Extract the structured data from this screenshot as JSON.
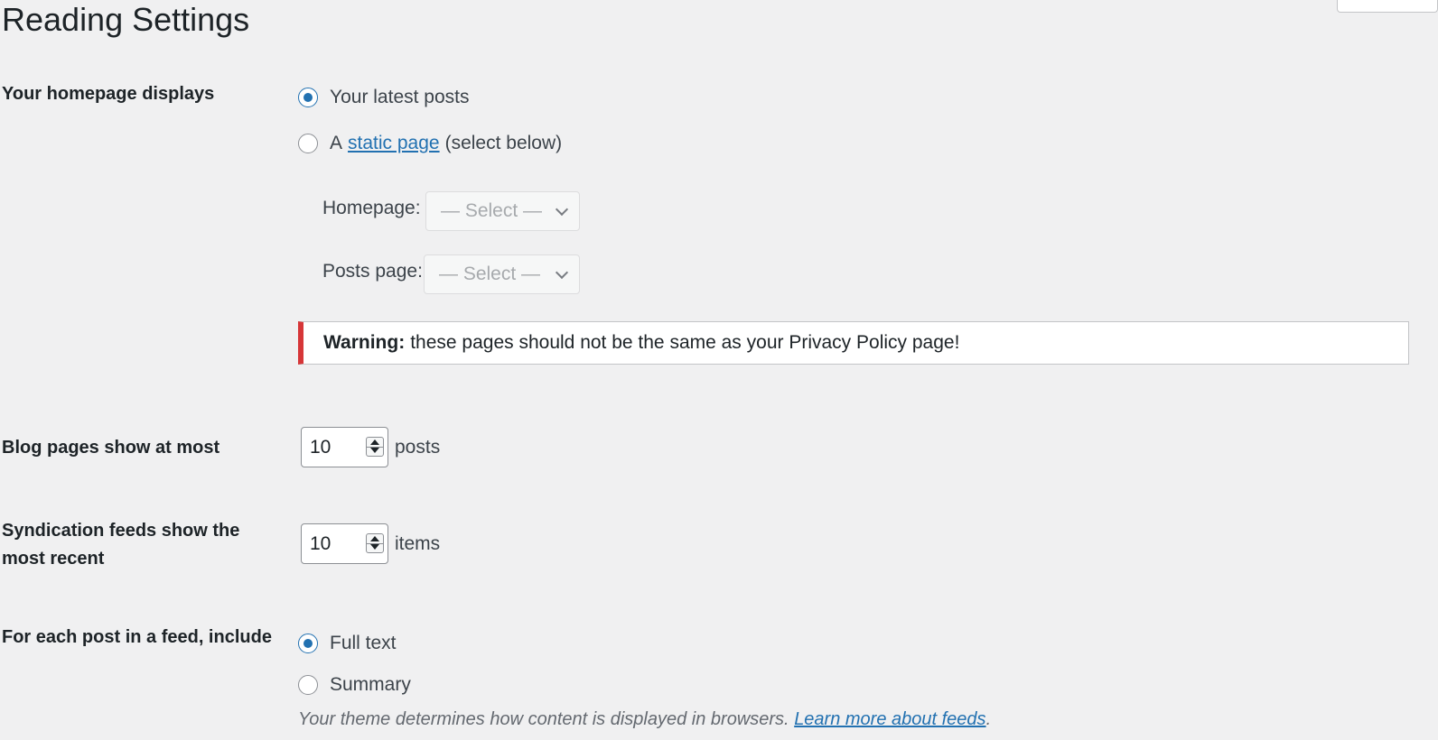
{
  "page": {
    "title": "Reading Settings"
  },
  "homepage_displays": {
    "label": "Your homepage displays",
    "option_latest": "Your latest posts",
    "option_static_prefix": "A",
    "option_static_link": "static page",
    "option_static_suffix": "(select below)",
    "selected": "latest",
    "homepage_label": "Homepage:",
    "homepage_select": "— Select —",
    "posts_page_label": "Posts page:",
    "posts_page_select": "— Select —"
  },
  "warning": {
    "strong": "Warning:",
    "text": "these pages should not be the same as your Privacy Policy page!"
  },
  "blog_pages": {
    "label": "Blog pages show at most",
    "value": "10",
    "unit": "posts"
  },
  "syndication": {
    "label_line1": "Syndication feeds show the",
    "label_line2": "most recent",
    "value": "10",
    "unit": "items"
  },
  "feed_include": {
    "label": "For each post in a feed, include",
    "option_full": "Full text",
    "option_summary": "Summary",
    "selected": "full",
    "description": "Your theme determines how content is displayed in browsers.",
    "description_link": "Learn more about feeds",
    "description_end": "."
  },
  "colors": {
    "accent": "#2271b1",
    "warning_border": "#d63638",
    "background": "#f0f0f1"
  }
}
